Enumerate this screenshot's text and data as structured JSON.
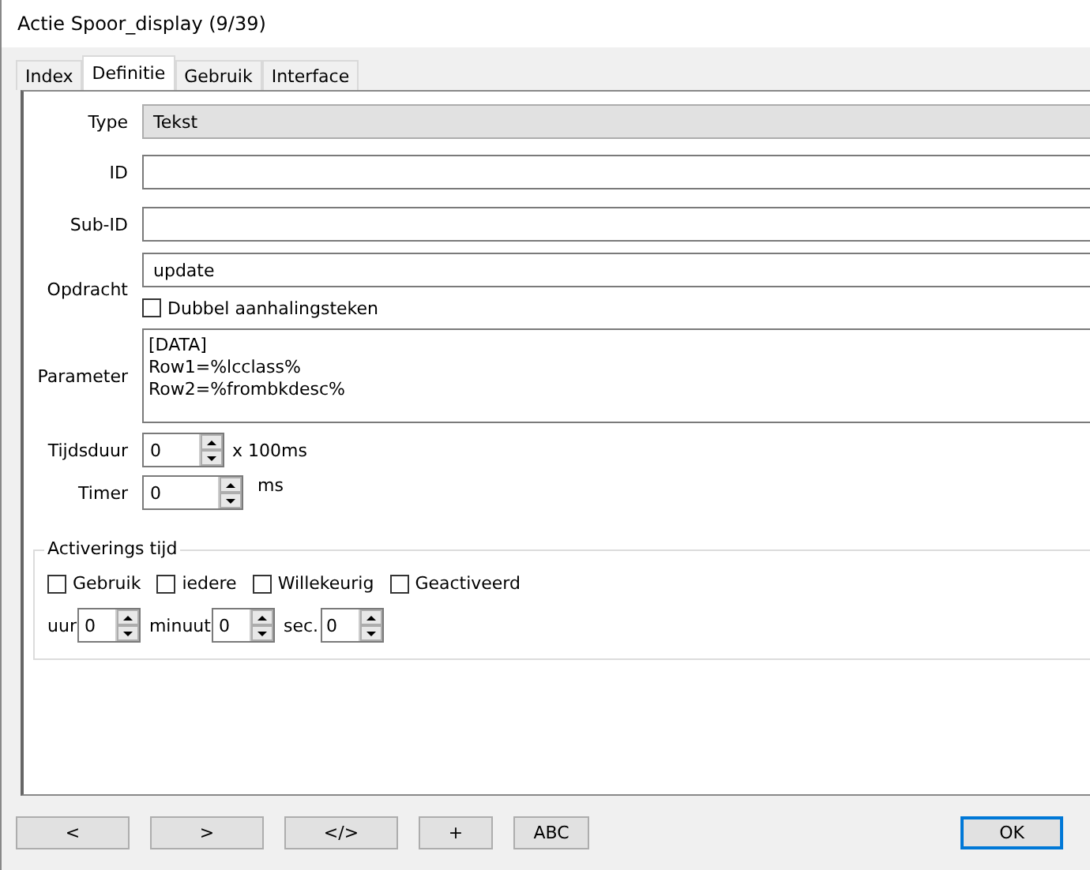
{
  "window": {
    "title": "Actie Spoor_display (9/39)"
  },
  "tabs": [
    {
      "label": "Index",
      "selected": false
    },
    {
      "label": "Definitie",
      "selected": true
    },
    {
      "label": "Gebruik",
      "selected": false
    },
    {
      "label": "Interface",
      "selected": false
    }
  ],
  "form": {
    "type": {
      "label": "Type",
      "value": "Tekst"
    },
    "id": {
      "label": "ID"
    },
    "sub_id": {
      "label": "Sub-ID"
    },
    "opdracht": {
      "label": "Opdracht",
      "value": "update"
    },
    "dubbel": {
      "label": "Dubbel aanhalingsteken",
      "checked": false
    },
    "parameter": {
      "label": "Parameter",
      "lines": [
        "[DATA]",
        "Row1=%lcclass%",
        "Row2=%frombkdesc%"
      ]
    },
    "tijdsduur": {
      "label": "Tijdsduur",
      "value": "0",
      "unit": "x 100ms"
    },
    "timer": {
      "label": "Timer",
      "value": "0",
      "unit": "ms"
    }
  },
  "activation": {
    "title": "Activerings tijd",
    "checkboxes": [
      {
        "label": "Gebruik",
        "checked": false
      },
      {
        "label": "iedere",
        "checked": false
      },
      {
        "label": "Willekeurig",
        "checked": false
      },
      {
        "label": "Geactiveerd",
        "checked": false
      }
    ],
    "spinners": [
      {
        "label": "uur",
        "value": "0"
      },
      {
        "label": "minuut",
        "value": "0"
      },
      {
        "label": "sec.",
        "value": "0"
      }
    ]
  },
  "buttons": [
    {
      "label": "<",
      "default": false
    },
    {
      "label": ">",
      "default": false
    },
    {
      "label": "</>",
      "default": false
    },
    {
      "label": "+",
      "default": false
    },
    {
      "label": "ABC",
      "default": false
    },
    {
      "label": "OK",
      "default": true
    }
  ]
}
